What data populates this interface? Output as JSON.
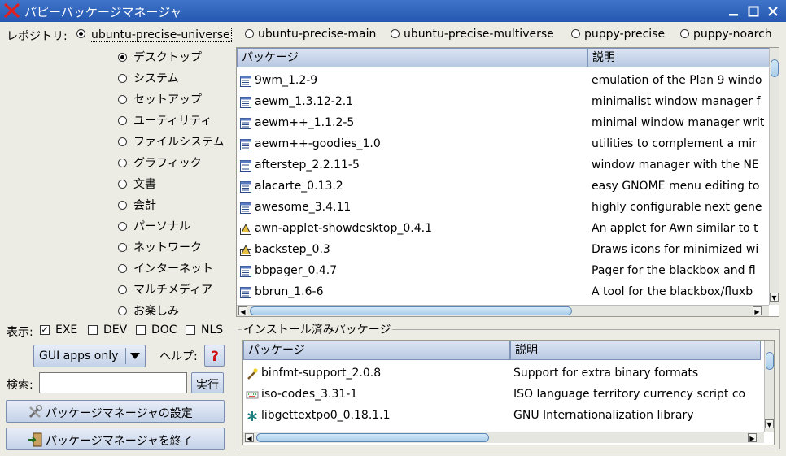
{
  "window": {
    "title": "パピーパッケージマネージャ"
  },
  "repo": {
    "label": "レポジトリ:",
    "options": [
      "ubuntu-precise-universe",
      "ubuntu-precise-main",
      "ubuntu-precise-multiverse",
      "puppy-precise",
      "puppy-noarch"
    ],
    "selected": "ubuntu-precise-universe"
  },
  "categories": {
    "items": [
      "デスクトップ",
      "システム",
      "セットアップ",
      "ユーティリティ",
      "ファイルシステム",
      "グラフィック",
      "文書",
      "会計",
      "パーソナル",
      "ネットワーク",
      "インターネット",
      "マルチメディア",
      "お楽しみ"
    ],
    "selected": "デスクトップ"
  },
  "packages": {
    "headers": {
      "name": "パッケージ",
      "desc": "説明"
    },
    "rows": [
      {
        "icon": "package-icon",
        "name": "9wm_1.2-9",
        "desc": "emulation of the Plan 9 windo"
      },
      {
        "icon": "package-icon",
        "name": "aewm_1.3.12-2.1",
        "desc": "minimalist window manager f"
      },
      {
        "icon": "package-icon",
        "name": "aewm++_1.1.2-5",
        "desc": "minimal window manager writ"
      },
      {
        "icon": "package-icon",
        "name": "aewm++-goodies_1.0",
        "desc": "utilities to complement a mir"
      },
      {
        "icon": "package-icon",
        "name": "afterstep_2.2.11-5",
        "desc": "window manager with the NE"
      },
      {
        "icon": "package-icon",
        "name": "alacarte_0.13.2",
        "desc": "easy GNOME menu editing to"
      },
      {
        "icon": "package-icon",
        "name": "awesome_3.4.11",
        "desc": "highly configurable next gene"
      },
      {
        "icon": "applet-icon",
        "name": "awn-applet-showdesktop_0.4.1",
        "desc": "An applet for Awn similar to t"
      },
      {
        "icon": "applet-icon",
        "name": "backstep_0.3",
        "desc": "Draws icons for minimized wi"
      },
      {
        "icon": "package-icon",
        "name": "bbpager_0.4.7",
        "desc": "Pager for the blackbox and fl"
      },
      {
        "icon": "package-icon",
        "name": "bbrun_1.6-6",
        "desc": "A tool for the blackbox/fluxb"
      }
    ]
  },
  "display": {
    "label": "表示:",
    "options": [
      {
        "label": "EXE",
        "checked": true
      },
      {
        "label": "DEV",
        "checked": false
      },
      {
        "label": "DOC",
        "checked": false
      },
      {
        "label": "NLS",
        "checked": false
      }
    ]
  },
  "filter": {
    "value": "GUI apps only"
  },
  "help": {
    "label": "ヘルプ:"
  },
  "search": {
    "label": "検索:",
    "value": "",
    "button": "実行"
  },
  "actions": {
    "settings": "パッケージマネージャの設定",
    "quit": "パッケージマネージャを終了"
  },
  "installed": {
    "title": "インストール済みパッケージ",
    "headers": {
      "name": "パッケージ",
      "desc": "説明"
    },
    "rows": [
      {
        "icon": "wand-icon",
        "name": "binfmt-support_2.0.8",
        "desc": "Support for extra binary formats"
      },
      {
        "icon": "keyboard-icon",
        "name": "iso-codes_3.31-1",
        "desc": "ISO language territory currency script co"
      },
      {
        "icon": "asterisk-icon",
        "name": "libgettextpo0_0.18.1.1",
        "desc": "GNU Internationalization library"
      }
    ]
  },
  "colors": {
    "titlebar": "#2f66c0",
    "header": "#c4d2e8",
    "thumb": "#a9cdea"
  }
}
